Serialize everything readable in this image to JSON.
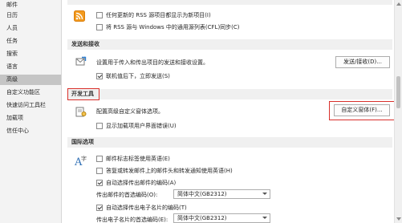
{
  "sidebar": {
    "items": [
      {
        "label": "邮件"
      },
      {
        "label": "日历"
      },
      {
        "label": "人员"
      },
      {
        "label": "任务"
      },
      {
        "label": "搜索"
      },
      {
        "label": "语言"
      },
      {
        "label": "高级"
      },
      {
        "label": "自定义功能区"
      },
      {
        "label": "快速访问工具栏"
      },
      {
        "label": "加载项"
      },
      {
        "label": "信任中心"
      }
    ]
  },
  "rss": {
    "opt1": "任何更新的 RSS 源项目都显示为新项目(I)",
    "opt2": "将 RSS 源与 Windows 中的通用源列表(CFL)同步(C)"
  },
  "send_receive": {
    "header": "发送和接收",
    "desc": "设置用于传入和传出项目的发送和接收设置。",
    "button": "发送/接收(D)...",
    "opt_immediate": "联机值后下，立即发送(S)"
  },
  "developer": {
    "header": "开发工具",
    "desc": "配置高级自定义窗体选项。",
    "button": "自定义窗体(F)...",
    "opt_addin_errors": "显示加载项用户界面错误(U)"
  },
  "international": {
    "header": "国际选项",
    "opt_english_flag": "邮件标志标签使用英语(E)",
    "opt_english_reply": "答复或转发邮件上的邮件头和转发通知使用英语(H)",
    "opt_auto_encoding": "自动选择传出邮件的编码(A)",
    "label_outgoing_encoding": "传出邮件的首选编码(O):",
    "select_outgoing_encoding": "简体中文(GB2312)",
    "opt_auto_vcard": "自动选择传出电子名片的编码(T)",
    "label_vcard_encoding": "传出电子名片的首选编码(E):",
    "select_vcard_encoding": "简体中文(GB2312)"
  },
  "colors": {
    "highlight": "#d9302b",
    "selected_nav": "#c5c5c5"
  }
}
